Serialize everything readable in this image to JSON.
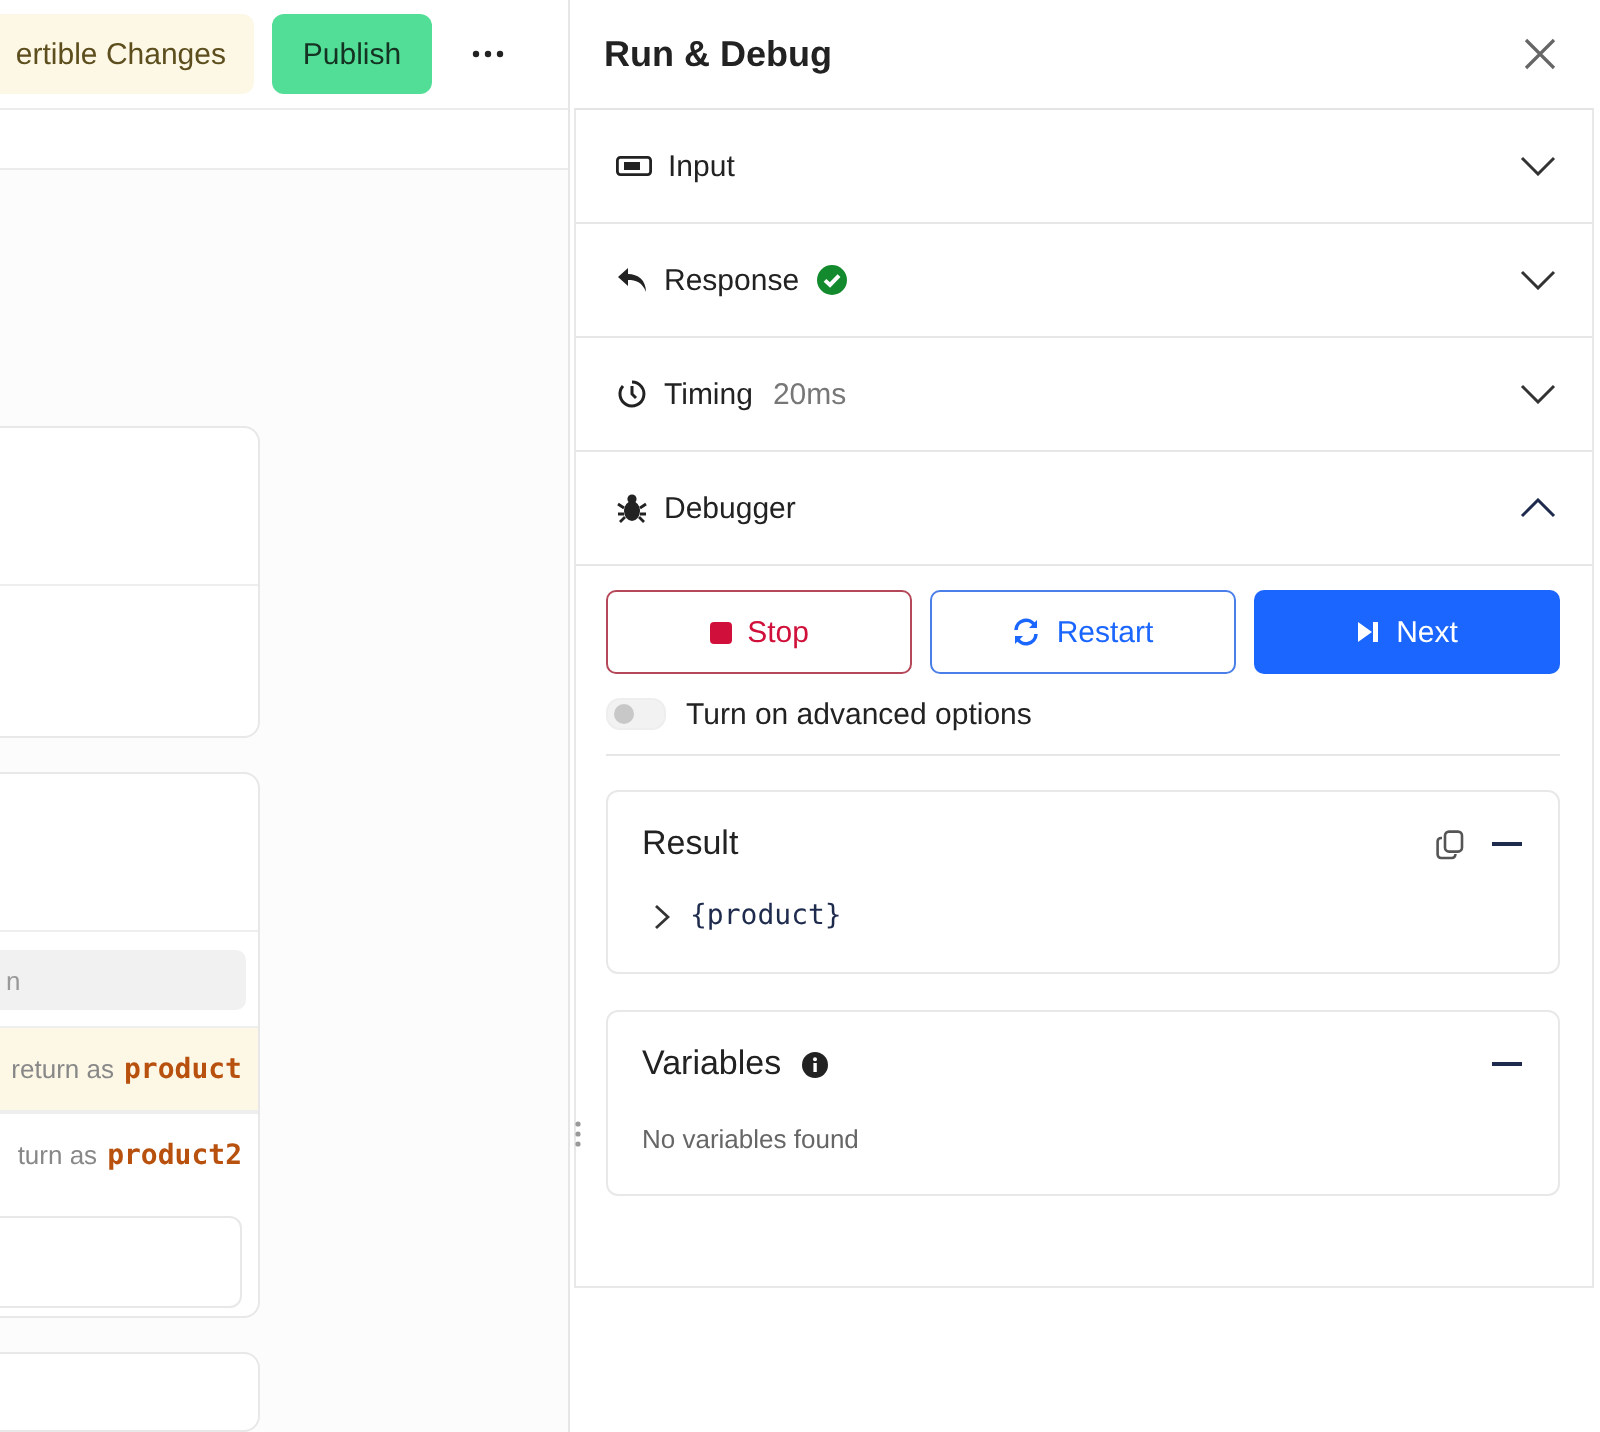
{
  "toolbar": {
    "changes_button": "ertible Changes",
    "publish_button": "Publish"
  },
  "canvas": {
    "field_placeholder": "n",
    "return_rows": [
      {
        "prefix": "return as",
        "name": "product",
        "selected": true
      },
      {
        "prefix": "turn as",
        "name": "product2",
        "selected": false
      }
    ]
  },
  "panel": {
    "title": "Run & Debug",
    "sections": [
      {
        "kind": "input",
        "label": "Input",
        "expanded": false
      },
      {
        "kind": "response",
        "label": "Response",
        "expanded": false
      },
      {
        "kind": "timing",
        "label": "Timing",
        "detail": "20ms",
        "expanded": false
      },
      {
        "kind": "debugger",
        "label": "Debugger",
        "expanded": true
      }
    ],
    "debugger": {
      "buttons": [
        {
          "kind": "stop",
          "label": "Stop"
        },
        {
          "kind": "restart",
          "label": "Restart"
        },
        {
          "kind": "next",
          "label": "Next"
        }
      ],
      "toggle": {
        "label": "Turn on advanced options",
        "on": false
      },
      "result": {
        "title": "Result",
        "items": [
          {
            "label": "{product}",
            "expanded": false
          }
        ]
      },
      "variables": {
        "title": "Variables",
        "empty_text": "No variables found"
      }
    }
  }
}
